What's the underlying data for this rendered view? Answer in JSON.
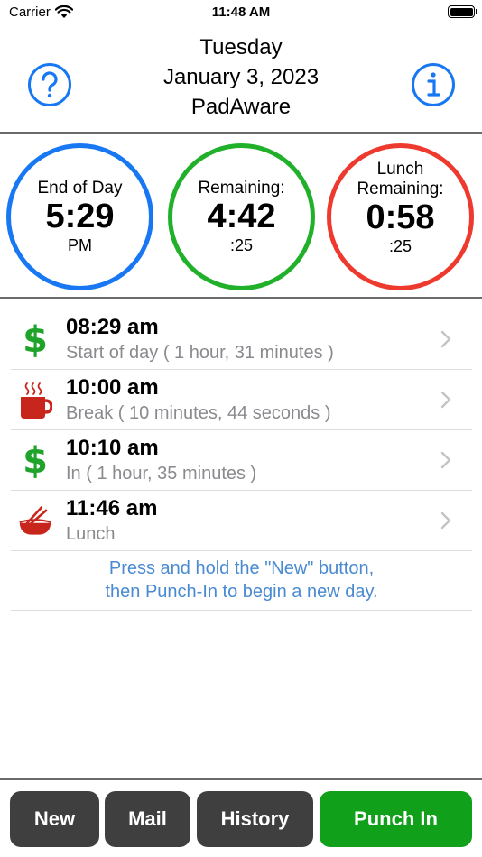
{
  "status_bar": {
    "carrier": "Carrier",
    "time": "11:48 AM"
  },
  "header": {
    "day": "Tuesday",
    "date": "January 3, 2023",
    "app_name": "PadAware",
    "help_icon": "question-circle-icon",
    "info_icon": "info-circle-icon"
  },
  "gauges": {
    "end_of_day": {
      "label": "End of Day",
      "value": "5:29",
      "sub": "PM",
      "color": "#1877f2"
    },
    "remaining": {
      "label": "Remaining:",
      "value": "4:42",
      "sub": ":25",
      "color": "#21b02a"
    },
    "lunch_remaining": {
      "label_line1": "Lunch",
      "label_line2": "Remaining:",
      "value": "0:58",
      "sub": ":25",
      "color": "#ee3a2e"
    }
  },
  "entries": [
    {
      "icon": "dollar-icon",
      "time": "08:29 am",
      "desc": "Start of day ( 1 hour, 31 minutes )"
    },
    {
      "icon": "coffee-mug-icon",
      "time": "10:00 am",
      "desc": "Break ( 10 minutes, 44 seconds )"
    },
    {
      "icon": "dollar-icon",
      "time": "10:10 am",
      "desc": "In ( 1 hour, 35 minutes )"
    },
    {
      "icon": "lunch-bowl-icon",
      "time": "11:46 am",
      "desc": "Lunch"
    }
  ],
  "dollar_glyph": "$",
  "hint": {
    "line1": "Press and hold the \"New\" button,",
    "line2": "then Punch-In to begin a new day."
  },
  "toolbar": {
    "new_label": "New",
    "mail_label": "Mail",
    "history_label": "History",
    "punch_in_label": "Punch In",
    "punch_in_color": "#10a01a"
  }
}
